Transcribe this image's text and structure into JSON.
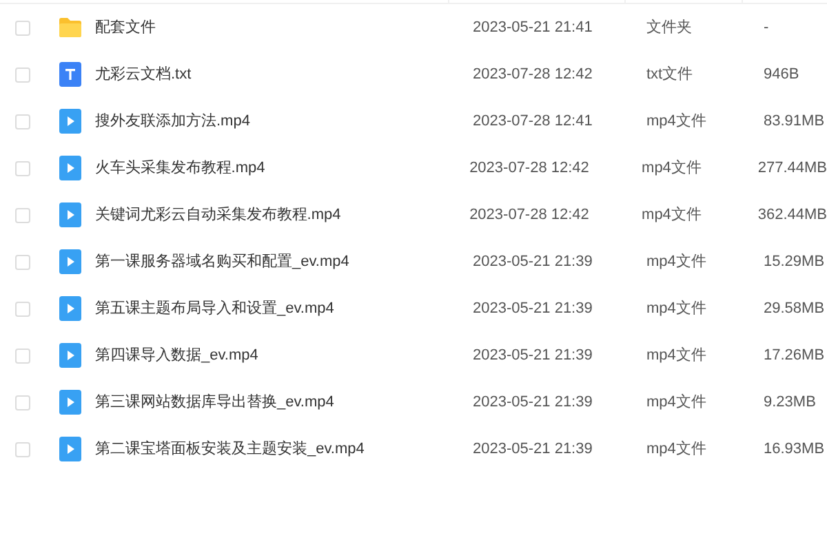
{
  "files": [
    {
      "kind": "folder",
      "checked": false,
      "name": "配套文件",
      "date": "2023-05-21 21:41",
      "type": "文件夹",
      "size": "-"
    },
    {
      "kind": "txt",
      "checked": false,
      "name": "尤彩云文档.txt",
      "date": "2023-07-28 12:42",
      "type": "txt文件",
      "size": "946B"
    },
    {
      "kind": "video",
      "checked": false,
      "name": "搜外友联添加方法.mp4",
      "date": "2023-07-28 12:41",
      "type": "mp4文件",
      "size": "83.91MB"
    },
    {
      "kind": "video",
      "checked": false,
      "name": "火车头采集发布教程.mp4",
      "date": "2023-07-28 12:42",
      "type": "mp4文件",
      "size": "277.44MB"
    },
    {
      "kind": "video",
      "checked": false,
      "name": "关键词尤彩云自动采集发布教程.mp4",
      "date": "2023-07-28 12:42",
      "type": "mp4文件",
      "size": "362.44MB"
    },
    {
      "kind": "video",
      "checked": false,
      "name": "第一课服务器域名购买和配置_ev.mp4",
      "date": "2023-05-21 21:39",
      "type": "mp4文件",
      "size": "15.29MB"
    },
    {
      "kind": "video",
      "checked": false,
      "name": "第五课主题布局导入和设置_ev.mp4",
      "date": "2023-05-21 21:39",
      "type": "mp4文件",
      "size": "29.58MB"
    },
    {
      "kind": "video",
      "checked": false,
      "name": "第四课导入数据_ev.mp4",
      "date": "2023-05-21 21:39",
      "type": "mp4文件",
      "size": "17.26MB"
    },
    {
      "kind": "video",
      "checked": false,
      "name": "第三课网站数据库导出替换_ev.mp4",
      "date": "2023-05-21 21:39",
      "type": "mp4文件",
      "size": "9.23MB"
    },
    {
      "kind": "video",
      "checked": false,
      "name": "第二课宝塔面板安装及主题安装_ev.mp4",
      "date": "2023-05-21 21:39",
      "type": "mp4文件",
      "size": "16.93MB"
    }
  ]
}
